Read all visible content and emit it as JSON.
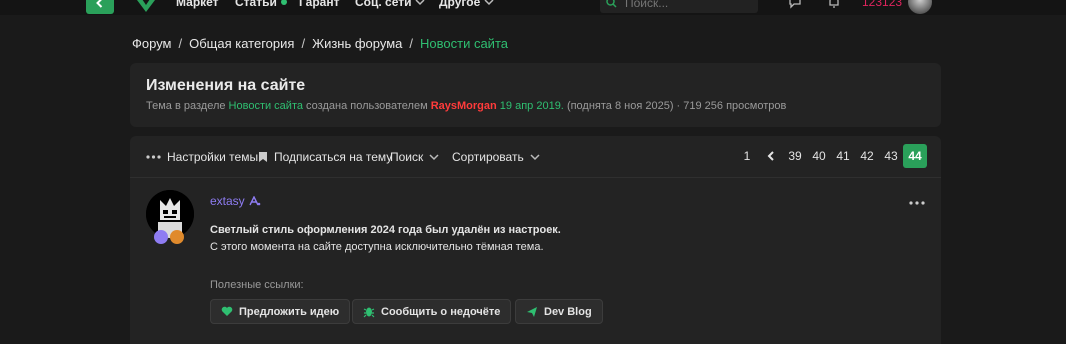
{
  "nav": {
    "items": [
      {
        "label": "Маркет"
      },
      {
        "label": "Статьи"
      },
      {
        "label": "Гарант"
      },
      {
        "label": "Соц. сети"
      },
      {
        "label": "Другое"
      }
    ],
    "search_placeholder": "Поиск...",
    "balance": "123123"
  },
  "breadcrumb": {
    "items": [
      "Форум",
      "Общая категория",
      "Жизнь форума"
    ],
    "current": "Новости сайта",
    "separator": "/"
  },
  "thread": {
    "title": "Изменения на сайте",
    "meta": {
      "prefix": "Тема в разделе",
      "section": "Новости сайта",
      "created_by": "создана пользователем",
      "author": "RaysMorgan",
      "date": "19 апр 2019.",
      "bumped": "(поднята 8 ноя 2025)",
      "views": "· 719 256 просмотров"
    }
  },
  "toolbar": {
    "settings": "Настройки темы",
    "subscribe": "Подписаться на тему",
    "search": "Поиск",
    "sort": "Сортировать"
  },
  "pager": {
    "first": "1",
    "pages": [
      "39",
      "40",
      "41",
      "42",
      "43"
    ],
    "current": "44"
  },
  "post": {
    "username": "extasy",
    "line1": "Светлый стиль оформления 2024 года был удалён из настроек.",
    "line2": "С этого момента на сайте доступна исключительно тёмная тема.",
    "links_label": "Полезные ссылки:",
    "links": [
      {
        "label": "Предложить идею",
        "icon": "heart-icon",
        "color": "#2fbf71"
      },
      {
        "label": "Сообщить о недочёте",
        "icon": "bug-icon",
        "color": "#2fbf71"
      },
      {
        "label": "Dev Blog",
        "icon": "send-icon",
        "color": "#2fbf71"
      }
    ]
  },
  "colors": {
    "accent": "#2aa05a",
    "link_green": "#2fbf71",
    "author_red": "#ff3b3b",
    "username_purple": "#8e7cf2",
    "balance_pink": "#e0245e"
  }
}
